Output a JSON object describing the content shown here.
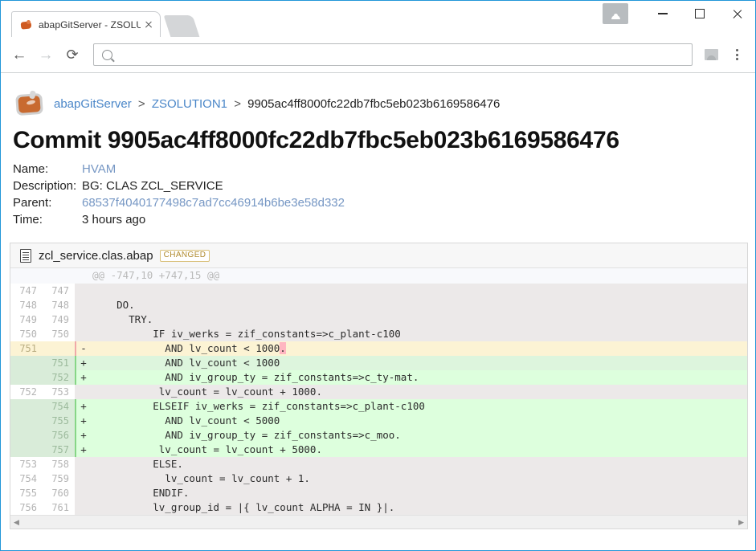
{
  "browser": {
    "tab": {
      "title": "abapGitServer - ZSOLUTI",
      "favicon_icon": "abapgit-favicon",
      "close_icon": "close-icon"
    },
    "new_tab_icon": "new-tab-ghost",
    "window_controls": {
      "profile_icon": "user-profile-icon",
      "minimize_icon": "minimize-icon",
      "maximize_icon": "maximize-icon",
      "close_icon": "window-close-icon"
    },
    "toolbar": {
      "back_icon": "back-arrow-icon",
      "forward_icon": "forward-arrow-icon",
      "reload_icon": "reload-icon",
      "search_icon": "search-icon",
      "address_value": "",
      "address_placeholder": "",
      "image_icon": "broken-image-icon",
      "menu_icon": "three-dot-menu-icon"
    }
  },
  "header": {
    "logo_icon": "abapgit-logo-icon",
    "breadcrumb": {
      "root": "abapGitServer",
      "repo": "ZSOLUTION1",
      "commit": "9905ac4ff8000fc22db7fbc5eb023b6169586476",
      "separator": ">"
    },
    "title": "Commit 9905ac4ff8000fc22db7fbc5eb023b6169586476"
  },
  "meta": {
    "rows": [
      {
        "label": "Name:",
        "value": "HVAM",
        "link": true
      },
      {
        "label": "Description:",
        "value": "BG: CLAS ZCL_SERVICE",
        "link": false
      },
      {
        "label": "Parent:",
        "value": "68537f4040177498c7ad7cc46914b6be3e58d332",
        "link": true
      },
      {
        "label": "Time:",
        "value": "3 hours ago",
        "link": false
      }
    ]
  },
  "diff": {
    "file_icon": "file-document-icon",
    "file_name": "zcl_service.clas.abap",
    "status_badge": "CHANGED",
    "hunk_header": "@@ -747,10 +747,15 @@",
    "scrollbar": {
      "left_arrow": "◀",
      "right_arrow": "▶"
    },
    "lines": [
      {
        "type": "ctx",
        "old": "747",
        "new": "747",
        "marker": "",
        "code": ""
      },
      {
        "type": "ctx",
        "old": "748",
        "new": "748",
        "marker": "",
        "code": "    DO."
      },
      {
        "type": "ctx",
        "old": "749",
        "new": "749",
        "marker": "",
        "code": "      TRY."
      },
      {
        "type": "ctx",
        "old": "750",
        "new": "750",
        "marker": "",
        "code": "          IF iv_werks = zif_constants=>c_plant-c100"
      },
      {
        "type": "del",
        "old": "751",
        "new": "",
        "marker": "-",
        "code": "            AND lv_count < 1000",
        "word_suffix": "."
      },
      {
        "type": "add",
        "old": "",
        "new": "751",
        "marker": "+",
        "code": "            AND lv_count < 1000"
      },
      {
        "type": "add_bright",
        "old": "",
        "new": "752",
        "marker": "+",
        "code": "            AND iv_group_ty = zif_constants=>c_ty-mat."
      },
      {
        "type": "ctx",
        "old": "752",
        "new": "753",
        "marker": "",
        "code": "           lv_count = lv_count + 1000."
      },
      {
        "type": "add_bright",
        "old": "",
        "new": "754",
        "marker": "+",
        "code": "          ELSEIF iv_werks = zif_constants=>c_plant-c100"
      },
      {
        "type": "add_bright",
        "old": "",
        "new": "755",
        "marker": "+",
        "code": "            AND lv_count < 5000"
      },
      {
        "type": "add_bright",
        "old": "",
        "new": "756",
        "marker": "+",
        "code": "            AND iv_group_ty = zif_constants=>c_moo."
      },
      {
        "type": "add_bright",
        "old": "",
        "new": "757",
        "marker": "+",
        "code": "           lv_count = lv_count + 5000."
      },
      {
        "type": "ctx",
        "old": "753",
        "new": "758",
        "marker": "",
        "code": "          ELSE."
      },
      {
        "type": "ctx",
        "old": "754",
        "new": "759",
        "marker": "",
        "code": "            lv_count = lv_count + 1."
      },
      {
        "type": "ctx",
        "old": "755",
        "new": "760",
        "marker": "",
        "code": "          ENDIF."
      },
      {
        "type": "ctx",
        "old": "756",
        "new": "761",
        "marker": "",
        "code": "          lv_group_id = |{ lv_count ALPHA = IN }|."
      }
    ]
  },
  "colors": {
    "window_border": "#2196d8",
    "link": "#4a86c8",
    "badge_border": "#d9c07a",
    "badge_text": "#b08a2e",
    "added_bg": "#ddffdd",
    "removed_bg": "#fcf3d4",
    "context_bg": "#ece9e9",
    "word_diff_bg": "#ffb6c1"
  }
}
